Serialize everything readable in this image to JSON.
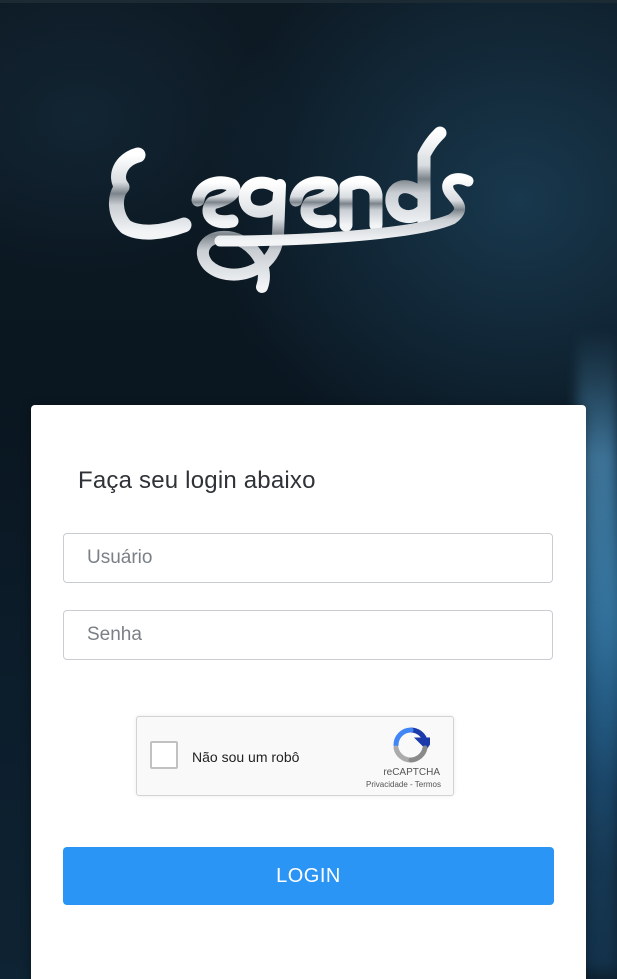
{
  "brand": {
    "logo_text": "Legends"
  },
  "login_card": {
    "title": "Faça seu login abaixo",
    "username_placeholder": "Usuário",
    "username_value": "",
    "password_placeholder": "Senha",
    "password_value": "",
    "recaptcha": {
      "checkbox_label": "Não sou um robô",
      "brand": "reCAPTCHA",
      "links": "Privacidade - Termos",
      "checked": false
    },
    "login_label": "LOGIN"
  },
  "colors": {
    "accent_button": "#2b95f5",
    "card_background": "#ffffff",
    "page_background": "#0a1620"
  },
  "icons": {
    "logo": "legends-logo",
    "recaptcha": "recaptcha-logo-icon"
  }
}
